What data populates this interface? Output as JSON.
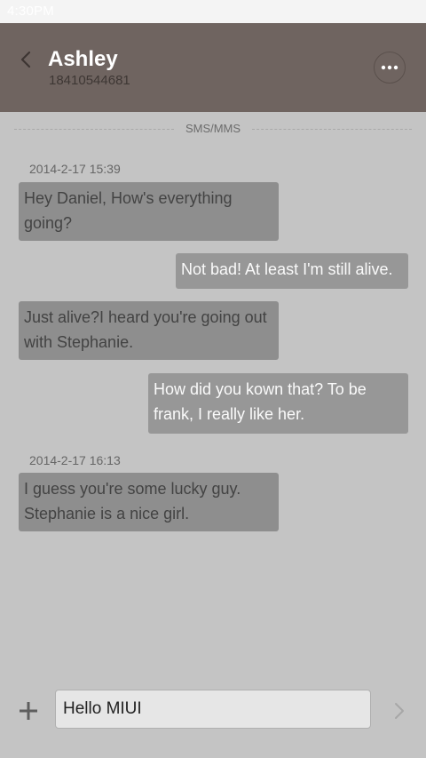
{
  "status_bar": {
    "time": "4:30PM"
  },
  "header": {
    "contact_name": "Ashley",
    "contact_number": "18410544681"
  },
  "thread": {
    "channel_label": "SMS/MMS",
    "groups": [
      {
        "timestamp": "2014-2-17 15:39",
        "messages": [
          {
            "direction": "incoming",
            "text": "Hey Daniel, How's everything going?"
          },
          {
            "direction": "outgoing",
            "text": "Not bad! At least I'm still alive."
          },
          {
            "direction": "incoming",
            "text": "Just  alive?I heard you're going out with Stephanie."
          },
          {
            "direction": "outgoing",
            "text": "How did you kown that? To be frank, I really like her."
          }
        ]
      },
      {
        "timestamp": "2014-2-17 16:13",
        "messages": [
          {
            "direction": "incoming",
            "text": "I guess you're some lucky guy. Stephanie is a nice girl."
          }
        ]
      }
    ]
  },
  "composer": {
    "value": "Hello MIUI"
  },
  "icons": {
    "back": "chevron-left-icon",
    "more": "more-horizontal-icon",
    "add": "plus-icon",
    "send": "chevron-right-icon"
  },
  "colors": {
    "header_bg": "#6f6460",
    "screen_bg": "#c4c4c4",
    "incoming_bubble": "#8e8e8e",
    "outgoing_bubble": "#979797",
    "caret": "#e08a2a"
  }
}
